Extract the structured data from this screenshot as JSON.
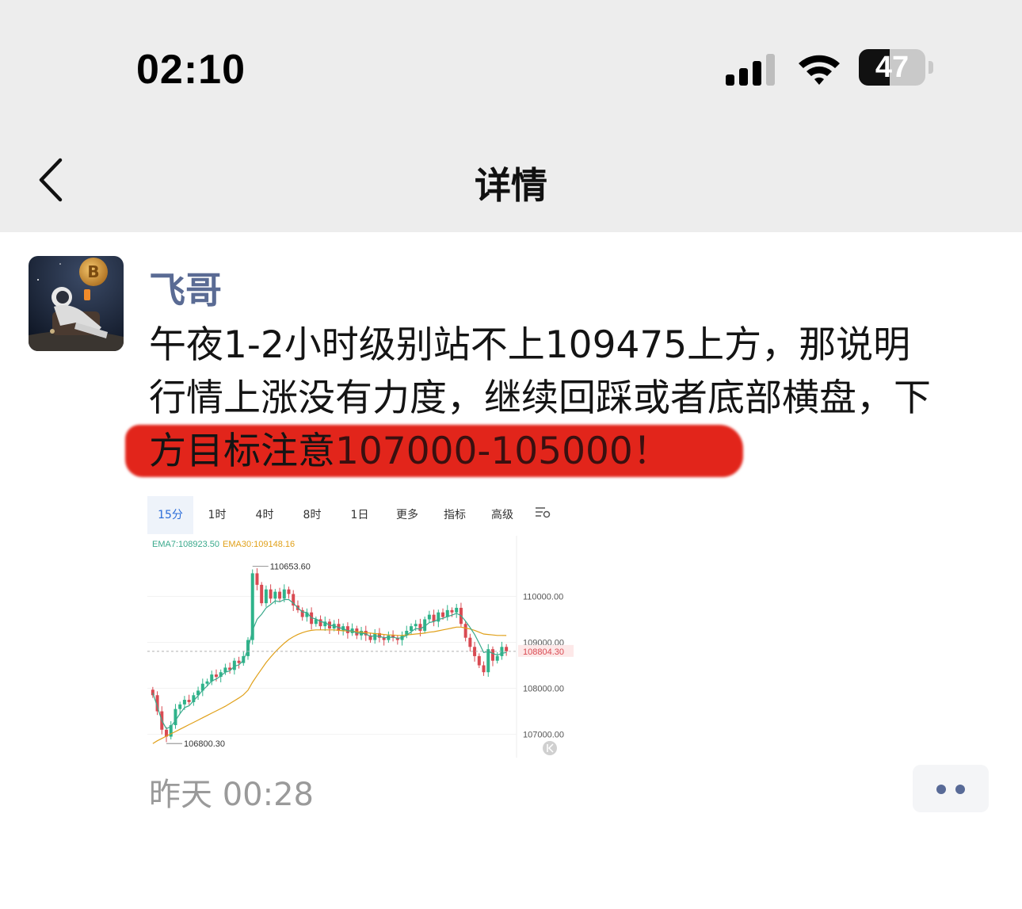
{
  "status_bar": {
    "time": "02:10",
    "battery": "47",
    "battery_level": 0.47
  },
  "nav": {
    "title": "详情",
    "back_icon": "chevron-left-icon"
  },
  "post": {
    "author": "飞哥",
    "avatar_icon": "astronaut-bitcoin-avatar",
    "text_line1": "午夜1-2小时级别站不上109475上方，那说明",
    "text_line2": "行情上涨没有力度，继续回踩或者底部横盘，下",
    "text_line3_a": "方目标注意",
    "text_line3_b": "107000-105000！",
    "timestamp": "昨天 00:28",
    "more_icon": "more-dots-icon",
    "highlight_color": "#e2251b",
    "author_color": "#5a6b94"
  },
  "chart_data": {
    "type": "candlestick",
    "tabs": [
      "15分",
      "1时",
      "4时",
      "8时",
      "1日",
      "更多",
      "指标",
      "高级"
    ],
    "active_tab": "15分",
    "settings_icon": "chart-settings-icon",
    "ema7_label": "EMA7:108923.50",
    "ema30_label": "EMA30:109148.16",
    "ema7_color": "#3aa98c",
    "ema30_color": "#e0a019",
    "up_color": "#2eb38a",
    "down_color": "#d94a52",
    "high_label": "110653.60",
    "low_label": "106800.30",
    "current_price": "108804.30",
    "y_ticks": [
      "110000.00",
      "109000.00",
      "108000.00",
      "107000.00"
    ],
    "ylim": [
      106700,
      110800
    ],
    "closes": [
      107850,
      107500,
      107100,
      106950,
      107200,
      107550,
      107650,
      107750,
      107700,
      107850,
      107950,
      108100,
      108150,
      108300,
      108250,
      108350,
      108450,
      108400,
      108600,
      108550,
      108700,
      109050,
      110500,
      110250,
      109850,
      110150,
      109950,
      110100,
      109950,
      110150,
      110050,
      109800,
      109700,
      109550,
      109650,
      109400,
      109500,
      109350,
      109450,
      109300,
      109400,
      109250,
      109350,
      109200,
      109300,
      109150,
      109250,
      109150,
      109050,
      109200,
      109100,
      109050,
      109150,
      109100,
      109050,
      109150,
      109250,
      109350,
      109400,
      109250,
      109500,
      109600,
      109450,
      109650,
      109550,
      109700,
      109650,
      109750,
      109400,
      109100,
      108900,
      108700,
      108500,
      108350,
      108850,
      108600,
      108700,
      108900,
      108805
    ],
    "ema7": [
      107900,
      107600,
      107300,
      107120,
      107170,
      107300,
      107450,
      107580,
      107620,
      107730,
      107840,
      107960,
      108050,
      108160,
      108200,
      108270,
      108350,
      108380,
      108480,
      108510,
      108610,
      108850,
      109260,
      109500,
      109610,
      109750,
      109820,
      109900,
      109880,
      109930,
      109930,
      109850,
      109750,
      109660,
      109650,
      109530,
      109510,
      109450,
      109430,
      109370,
      109360,
      109320,
      109300,
      109250,
      109250,
      109200,
      109200,
      109180,
      109130,
      109140,
      109130,
      109100,
      109110,
      109110,
      109090,
      109100,
      109150,
      109230,
      109300,
      109290,
      109350,
      109430,
      109450,
      109500,
      109520,
      109560,
      109590,
      109630,
      109580,
      109460,
      109320,
      109170,
      108980,
      108780,
      108800,
      108760,
      108720,
      108760,
      108780
    ],
    "ema30": [
      106800,
      106860,
      106910,
      106960,
      107010,
      107060,
      107110,
      107160,
      107210,
      107260,
      107310,
      107360,
      107410,
      107460,
      107510,
      107560,
      107610,
      107670,
      107730,
      107790,
      107860,
      107960,
      108130,
      108280,
      108420,
      108560,
      108680,
      108790,
      108890,
      108980,
      109060,
      109120,
      109170,
      109210,
      109240,
      109260,
      109270,
      109270,
      109270,
      109270,
      109270,
      109260,
      109250,
      109250,
      109240,
      109230,
      109220,
      109210,
      109200,
      109190,
      109180,
      109170,
      109160,
      109160,
      109150,
      109150,
      109160,
      109170,
      109180,
      109190,
      109200,
      109220,
      109230,
      109250,
      109270,
      109290,
      109310,
      109330,
      109330,
      109310,
      109290,
      109260,
      109220,
      109180,
      109170,
      109160,
      109150,
      109150,
      109148
    ]
  }
}
